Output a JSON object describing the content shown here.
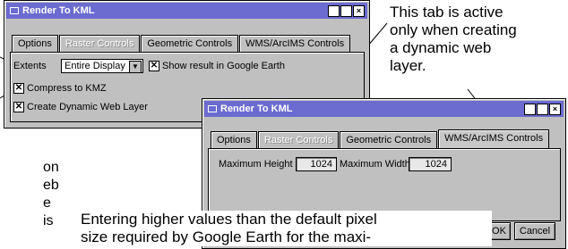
{
  "dialog1": {
    "title": "Render To KML",
    "tabs": [
      "Options",
      "Raster Controls",
      "Geometric Controls",
      "WMS/ArcIMS Controls"
    ],
    "extents_label": "Extents",
    "extents_value": "Entire Display",
    "show_google_earth": "Show result in Google Earth",
    "compress_kmz": "Compress to KMZ",
    "dynamic_layer": "Create Dynamic Web Layer"
  },
  "dialog2": {
    "title": "Render To KML",
    "tabs": [
      "Options",
      "Raster Controls",
      "Geometric Controls",
      "WMS/ArcIMS Controls"
    ],
    "max_height_label": "Maximum Height",
    "max_height_value": "1024",
    "max_width_label": "Maximum Width",
    "max_width_value": "1024",
    "ok": "OK",
    "cancel": "Cancel"
  },
  "callouts": {
    "tab_note_lines": [
      "This tab is active",
      "only when creating",
      "a dynamic web",
      "layer."
    ],
    "bottom_note_lines": [
      "Entering higher values than the default pixel",
      "size required by Google Earth for the maxi-"
    ],
    "left_fragments": [
      "on",
      "eb",
      "e",
      "is"
    ]
  }
}
